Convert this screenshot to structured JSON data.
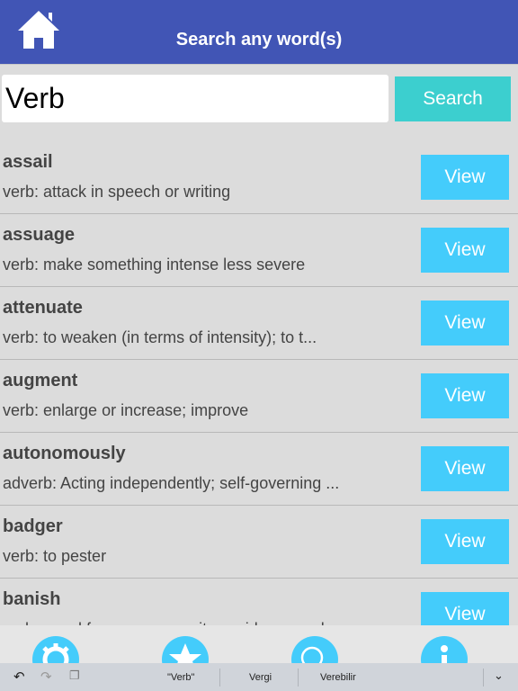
{
  "header": {
    "title": "Search any word(s)",
    "home_icon": "home-icon",
    "color": "#4155b5"
  },
  "search": {
    "value": "Verb",
    "button": "Search"
  },
  "results": [
    {
      "word": "assail",
      "definition": "verb: attack in speech or writing",
      "button": "View"
    },
    {
      "word": "assuage",
      "definition": "verb: make something intense less severe",
      "button": "View"
    },
    {
      "word": "attenuate",
      "definition": "verb: to weaken (in terms of intensity); to t...",
      "button": "View"
    },
    {
      "word": "augment",
      "definition": "verb: enlarge or increase; improve",
      "button": "View"
    },
    {
      "word": "autonomously",
      "definition": "adverb: Acting independently; self-governing ...",
      "button": "View"
    },
    {
      "word": "badger",
      "definition": "verb: to pester",
      "button": "View"
    },
    {
      "word": "banish",
      "definition": "verb: expel from a community, residence, or l...",
      "button": "View"
    }
  ],
  "tabs": [
    "gear-icon",
    "star-icon",
    "search-icon",
    "info-icon"
  ],
  "keyboard": {
    "suggestions": [
      "\"Verb\"",
      "Vergi",
      "Verebilir"
    ]
  }
}
